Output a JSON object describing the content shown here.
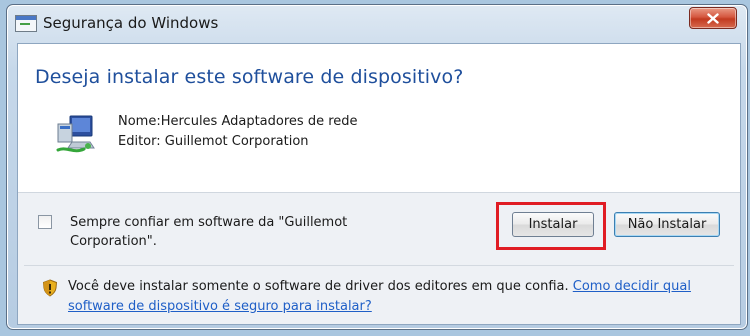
{
  "window": {
    "title": "Segurança do Windows",
    "close_label": "X"
  },
  "dialog": {
    "heading": "Deseja instalar este software de dispositivo?",
    "device_name": "Nome:Hercules Adaptadores de rede",
    "publisher": "Editor: Guillemot Corporation",
    "always_trust": {
      "label": "Sempre confiar em software da \"Guillemot Corporation\".",
      "checked": false
    },
    "buttons": {
      "install": "Instalar",
      "dont_install": "Não Instalar"
    },
    "warning": {
      "text": "Você deve instalar somente o software de driver dos editores em que confia.",
      "link": "Como decidir qual software de dispositivo é seguro para instalar?"
    }
  },
  "icons": {
    "window": "windows-security-icon",
    "device": "network-adapter-icon",
    "shield": "shield-warning-icon",
    "close": "close-icon"
  },
  "colors": {
    "heading": "#1f4f9c",
    "highlight": "#e01c24",
    "link": "#1f5fc7",
    "close_button": "#c23a20"
  }
}
